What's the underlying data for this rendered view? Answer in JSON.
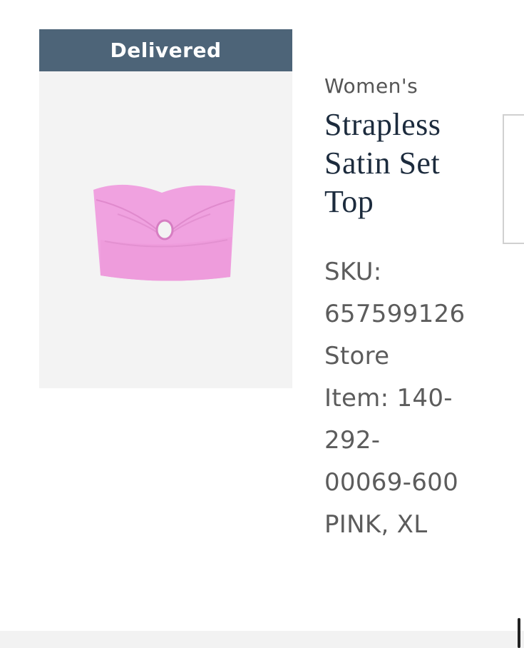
{
  "order_item": {
    "status": "Delivered",
    "category": "Women's",
    "title_lines": [
      "Strapless",
      "Satin Set",
      "Top"
    ],
    "meta_lines": [
      "SKU:",
      "657599126",
      "Store",
      "Item: 140-",
      "292-",
      "00069-600",
      "PINK, XL"
    ],
    "image_icon": "strapless-top-photo",
    "colors": {
      "status_banner": "#4d6478",
      "product": "#f2a3e0",
      "title": "#1c2b3d"
    }
  }
}
